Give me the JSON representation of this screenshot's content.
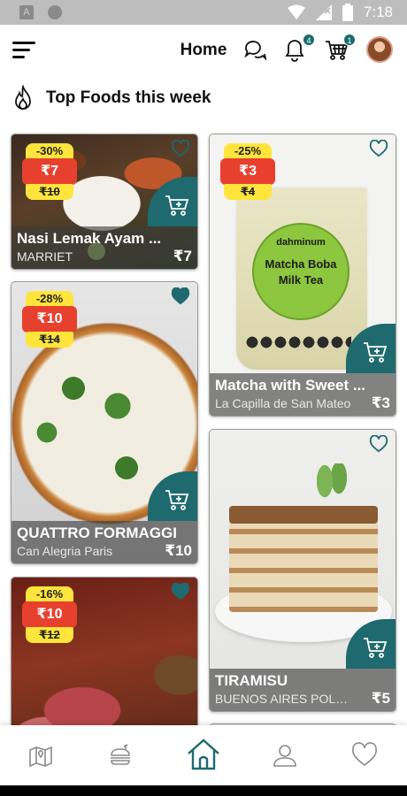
{
  "status_bar": {
    "time": "7:18",
    "left_icon_letter": "A"
  },
  "header": {
    "title": "Home",
    "icons": [
      "menu-icon",
      "chat-icon",
      "bell-icon",
      "cart-icon",
      "avatar"
    ],
    "notifications_count": "4",
    "cart_count": "1"
  },
  "section": {
    "title": "Top Foods this week",
    "icon": "flame-icon"
  },
  "cards": [
    {
      "name": "Nasi Lemak Ayam ...",
      "store": "MARRIET",
      "price": "₹7",
      "discount": "-30%",
      "price_now": "₹7",
      "price_was": "₹10",
      "favorited": false
    },
    {
      "name": "Matcha with Sweet ...",
      "store": "La Capilla de San Mateo",
      "price": "₹3",
      "discount": "-25%",
      "price_now": "₹3",
      "price_was": "₹4",
      "favorited": false,
      "cup_brand": "dahminum",
      "cup_label": "Matcha Boba Milk Tea"
    },
    {
      "name": "QUATTRO FORMAGGI",
      "store": "Can Alegria Paris",
      "price": "₹10",
      "discount": "-28%",
      "price_now": "₹10",
      "price_was": "₹14",
      "favorited": true
    },
    {
      "name": "TIRAMISU",
      "store": "BUENOS AIRES POLO ...",
      "price": "₹5",
      "favorited": false
    },
    {
      "discount": "-16%",
      "price_now": "₹10",
      "price_was": "₹12",
      "favorited": true
    }
  ],
  "bottom_nav": {
    "items": [
      "map-icon",
      "burger-icon",
      "home-icon",
      "user-icon",
      "heart-icon"
    ],
    "active": "home-icon"
  },
  "colors": {
    "accent": "#1e6a6e",
    "promo_red": "#e8402f",
    "promo_yellow": "#ffe53b"
  }
}
